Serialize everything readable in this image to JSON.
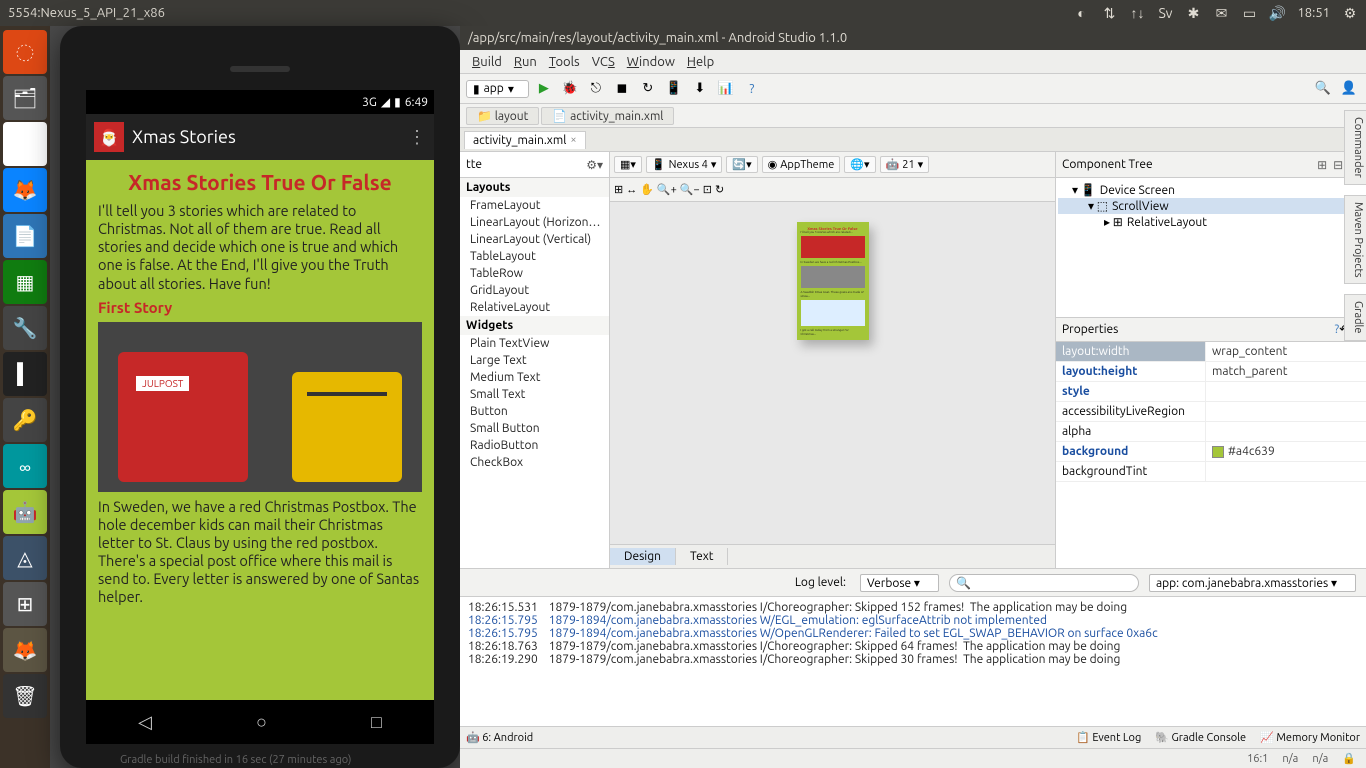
{
  "ubuntu": {
    "window_title": "5554:Nexus_5_API_21_x86",
    "time": "18:51"
  },
  "emulator": {
    "status": {
      "net": "3G",
      "time": "6:49"
    },
    "app_title": "Xmas Stories",
    "heading": "Xmas Stories True Or False",
    "intro": "I'll tell you 3 stories which are related to Christmas. Not all of them are true. Read all stories and decide which one is true and which one is false. At the End, I'll give you the Truth about all stories. Have fun!",
    "sub1": "First Story",
    "postlabel": "JULPOST",
    "story1": "In Sweden, we have a red Christmas Postbox. The hole december kids can mail their Christmas letter to St. Claus by using the red postbox. There's a special post office where this mail is send to. Every letter is answered by one of Santas helper."
  },
  "ide": {
    "title": "/app/src/main/res/layout/activity_main.xml - Android Studio 1.1.0",
    "menus": [
      "Build",
      "Run",
      "Tools",
      "VCS",
      "Window",
      "Help"
    ],
    "config": "app",
    "breadcrumbs": [
      "layout",
      "activity_main.xml"
    ],
    "tab": "activity_main.xml",
    "palette": {
      "head": "tte",
      "groups": [
        {
          "name": "Layouts",
          "items": [
            "FrameLayout",
            "LinearLayout (Horizontal)",
            "LinearLayout (Vertical)",
            "TableLayout",
            "TableRow",
            "GridLayout",
            "RelativeLayout"
          ]
        },
        {
          "name": "Widgets",
          "items": [
            "Plain TextView",
            "Large Text",
            "Medium Text",
            "Small Text",
            "Button",
            "Small Button",
            "RadioButton",
            "CheckBox"
          ]
        }
      ]
    },
    "design_toolbar": {
      "device": "Nexus 4",
      "theme": "AppTheme",
      "api": "21"
    },
    "footer_tabs": [
      "Design",
      "Text"
    ],
    "tree": {
      "head": "Component Tree",
      "nodes": [
        "Device Screen",
        "ScrollView",
        "RelativeLayout"
      ]
    },
    "props": {
      "head": "Properties",
      "rows": [
        {
          "k": "layout:width",
          "v": "wrap_content",
          "hl": true
        },
        {
          "k": "layout:height",
          "v": "match_parent",
          "blue": true
        },
        {
          "k": "style",
          "v": "",
          "blue": true
        },
        {
          "k": "accessibilityLiveRegion",
          "v": ""
        },
        {
          "k": "alpha",
          "v": ""
        },
        {
          "k": "background",
          "v": "#a4c639",
          "blue": true,
          "swatch": true
        },
        {
          "k": "backgroundTint",
          "v": ""
        }
      ]
    },
    "log": {
      "level_label": "Log level:",
      "level": "Verbose",
      "filter": "app: com.janebabra.xmasstories",
      "lines": [
        {
          "t": "18:26:15.531",
          "c": "1879-1879/com.janebabra.xmasstories I/Choreographer: Skipped 152 frames!  The application may be doing"
        },
        {
          "t": "18:26:15.795",
          "c": "1879-1894/com.janebabra.xmasstories W/EGL_emulation: eglSurfaceAttrib not implemented",
          "blue": true
        },
        {
          "t": "18:26:15.795",
          "c": "1879-1894/com.janebabra.xmasstories W/OpenGLRenderer: Failed to set EGL_SWAP_BEHAVIOR on surface 0xa6c",
          "blue": true
        },
        {
          "t": "18:26:18.763",
          "c": "1879-1879/com.janebabra.xmasstories I/Choreographer: Skipped 64 frames!  The application may be doing"
        },
        {
          "t": "18:26:19.290",
          "c": "1879-1879/com.janebabra.xmasstories I/Choreographer: Skipped 30 frames!  The application may be doing"
        }
      ]
    },
    "bottom_tabs": {
      "left": "6: Android",
      "right": [
        "Event Log",
        "Gradle Console",
        "Memory Monitor"
      ]
    },
    "status": {
      "pos": "16:1",
      "ins": "n/a",
      "enc": "n/a"
    },
    "side": [
      "Commander",
      "Maven Projects",
      "Gradle"
    ],
    "hidden": "Gradle build finished in 16 sec (27 minutes ago)"
  }
}
